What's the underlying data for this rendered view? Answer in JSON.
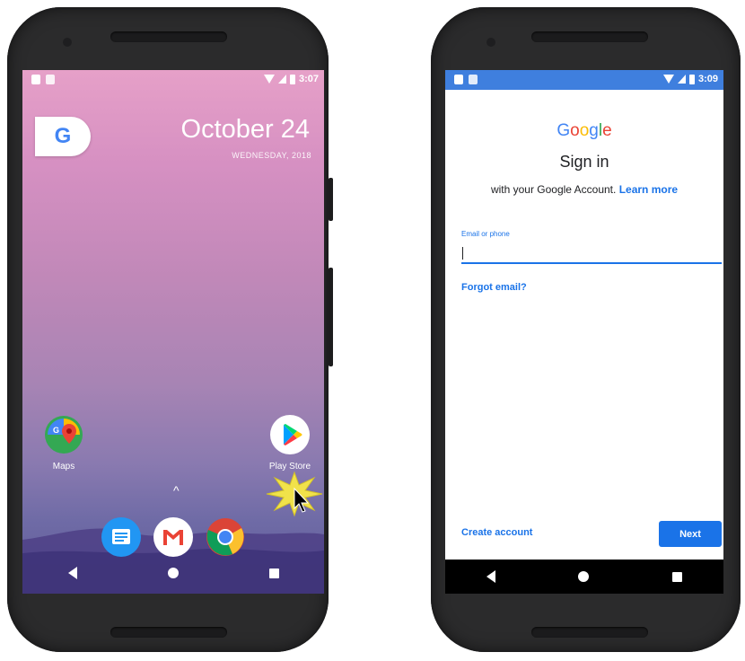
{
  "left_phone": {
    "status_time": "3:07",
    "google_pill_letter": "G",
    "date": "October 24",
    "weekday": "WEDNESDAY, 2018",
    "apps": [
      {
        "label": "Maps",
        "icon": "maps-icon"
      },
      {
        "label": "Play Store",
        "icon": "play-store-icon"
      }
    ],
    "dock": [
      "messages-icon",
      "gmail-icon",
      "chrome-icon"
    ],
    "drawer_caret": "^"
  },
  "right_phone": {
    "status_time": "3:09",
    "logo": "Google",
    "title": "Sign in",
    "subtitle": "with your Google Account.",
    "learn_more": "Learn more",
    "email_label": "Email or phone",
    "email_value": "",
    "forgot_email": "Forgot email?",
    "create_account": "Create account",
    "next": "Next"
  },
  "colors": {
    "accent": "#1a73e8",
    "statusbar_blue": "#3f7fde",
    "wallpaper_top": "#e6a0c8",
    "wallpaper_bottom": "#5e5a98"
  }
}
